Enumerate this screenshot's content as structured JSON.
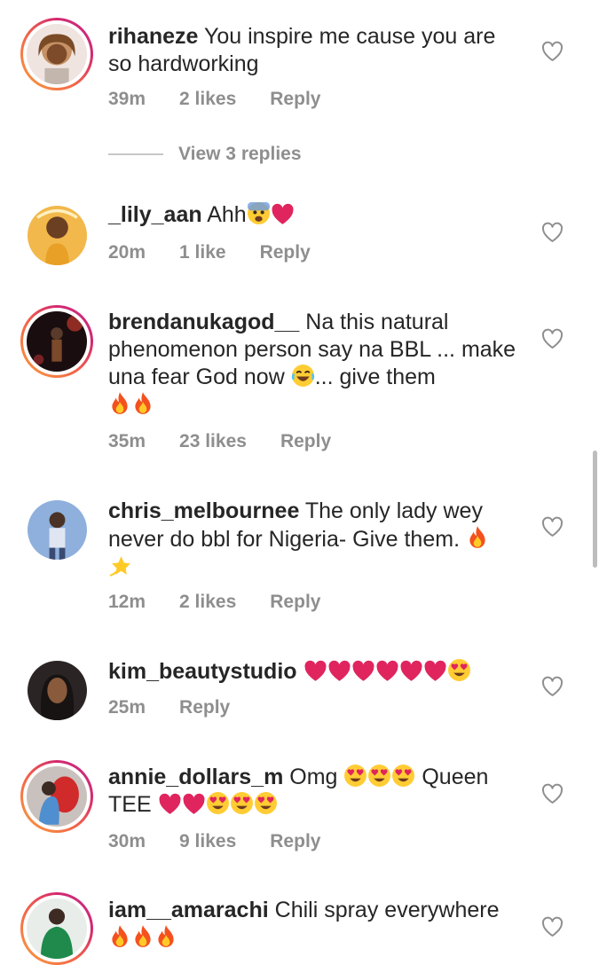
{
  "comments": [
    {
      "username": "rihaneze",
      "text": "You inspire me cause you are so hardworking",
      "time": "39m",
      "likes": "2 likes",
      "reply": "Reply"
    },
    {
      "username": "_lily_aan",
      "text": "Ahh",
      "time": "20m",
      "likes": "1 like",
      "reply": "Reply"
    },
    {
      "username": "brendanukagod__",
      "text": "Na this natural phenomenon person say na BBL ... make una fear God now",
      "text2": "... give them",
      "time": "35m",
      "likes": "23 likes",
      "reply": "Reply"
    },
    {
      "username": "chris_melbournee",
      "text": "The only lady wey never do bbl for Nigeria- Give them.",
      "time": "12m",
      "likes": "2 likes",
      "reply": "Reply"
    },
    {
      "username": "kim_beautystudio",
      "text": "",
      "time": "25m",
      "reply": "Reply"
    },
    {
      "username": "annie_dollars_m",
      "text": "Omg",
      "text2": "Queen TEE",
      "time": "30m",
      "likes": "9 likes",
      "reply": "Reply"
    },
    {
      "username": "iam__amarachi",
      "text": "Chili spray everywhere"
    }
  ],
  "view_replies": "View 3 replies",
  "icons": {
    "like": "heart-outline-icon"
  },
  "colors": {
    "muted": "#8e8e8e",
    "ring": "#d3276f"
  }
}
